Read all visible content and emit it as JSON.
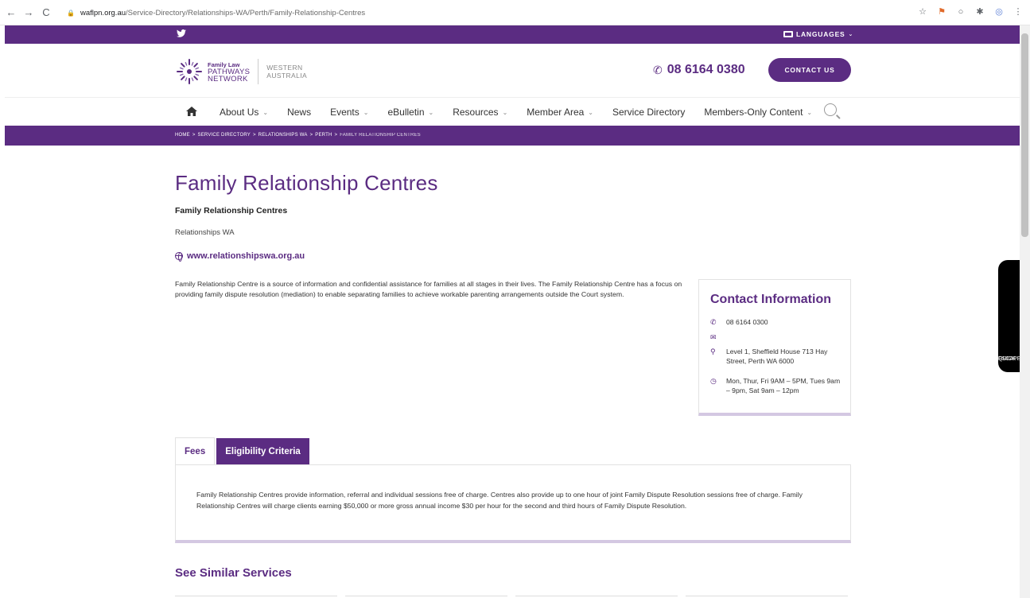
{
  "browser": {
    "url_domain": "waflpn.org.au",
    "url_path": "/Service-Directory/Relationships-WA/Perth/Family-Relationship-Centres"
  },
  "topbar": {
    "languages_label": "LANGUAGES"
  },
  "header": {
    "logo_line1": "Family Law",
    "logo_line2": "PATHWAYS",
    "logo_line3": "NETWORK",
    "region_line1": "WESTERN",
    "region_line2": "AUSTRALIA",
    "phone": "08 6164 0380",
    "contact_button": "CONTACT US"
  },
  "nav": {
    "items": [
      {
        "label": "About Us",
        "has_dropdown": true
      },
      {
        "label": "News",
        "has_dropdown": false
      },
      {
        "label": "Events",
        "has_dropdown": true
      },
      {
        "label": "eBulletin",
        "has_dropdown": true
      },
      {
        "label": "Resources",
        "has_dropdown": true
      },
      {
        "label": "Member Area",
        "has_dropdown": true
      },
      {
        "label": "Service Directory",
        "has_dropdown": false
      },
      {
        "label": "Members-Only Content",
        "has_dropdown": true
      }
    ]
  },
  "breadcrumb": [
    "HOME",
    "SERVICE DIRECTORY",
    "RELATIONSHIPS WA",
    "PERTH",
    "FAMILY RELATIONSHIP CENTRES"
  ],
  "page": {
    "title": "Family Relationship Centres",
    "subtitle": "Family Relationship Centres",
    "provider": "Relationships WA",
    "website": "www.relationshipswa.org.au",
    "description": "Family Relationship Centre is a source of information and confidential assistance for families at all stages in their lives. The Family Relationship Centre has a focus on providing family dispute resolution (mediation) to enable separating families to achieve workable parenting arrangements outside the Court system."
  },
  "contact": {
    "title": "Contact Information",
    "phone": "08 6164 0300",
    "email": "",
    "address": "Level 1, Sheffield House 713 Hay Street, Perth WA 6000",
    "hours": "Mon, Thur, Fri 9AM – 5PM, Tues 9am – 9pm, Sat 9am – 12pm"
  },
  "tabs": {
    "fees_label": "Fees",
    "eligibility_label": "Eligibility Criteria",
    "fees_text": "Family Relationship Centres provide information, referral and individual sessions free of charge. Centres also provide up to one hour of joint Family Dispute Resolution sessions free of charge. Family Relationship Centres will charge clients earning $50,000 or more gross annual income $30 per hour for the second and third hours of Family Dispute Resolution."
  },
  "similar": {
    "heading": "See Similar Services"
  },
  "quick_escape": {
    "line1": "QUICK",
    "line2": "ESCAPE"
  },
  "colors": {
    "brand_purple": "#5b2c82",
    "accent_light": "#d4c8e2"
  }
}
